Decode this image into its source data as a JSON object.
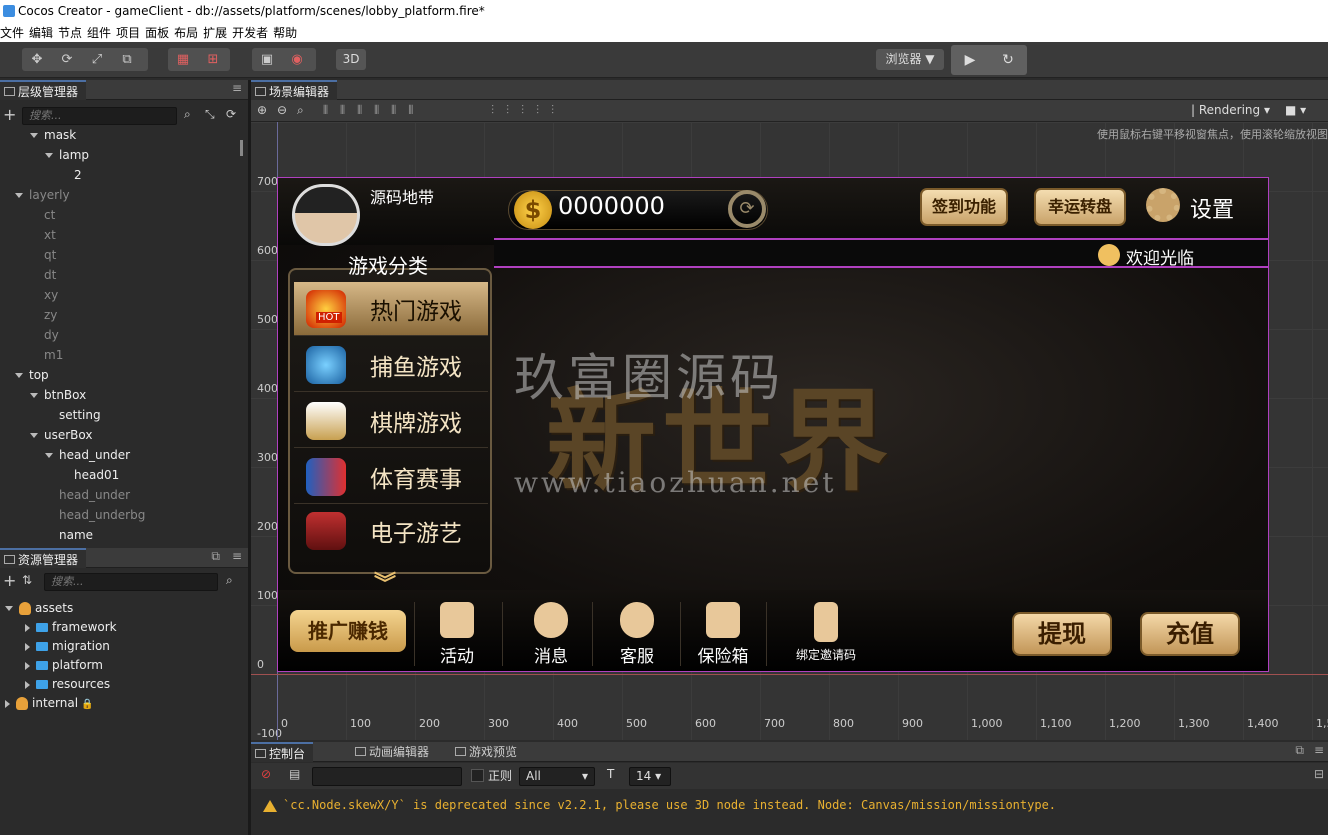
{
  "window": {
    "title": "Cocos Creator - gameClient - db://assets/platform/scenes/lobby_platform.fire*"
  },
  "menu": [
    "文件",
    "编辑",
    "节点",
    "组件",
    "项目",
    "面板",
    "布局",
    "扩展",
    "开发者",
    "帮助"
  ],
  "toolbar": {
    "mode_3d": "3D",
    "browser": "浏览器 ▼",
    "play": "▶",
    "reload": "↻"
  },
  "hierarchy": {
    "tab": "层级管理器",
    "search_placeholder": "搜索...",
    "items": [
      {
        "label": "mask",
        "depth": 2,
        "expanded": true,
        "dim": false
      },
      {
        "label": "lamp",
        "depth": 3,
        "expanded": true,
        "dim": false
      },
      {
        "label": "2",
        "depth": 4,
        "expanded": null,
        "dim": false
      },
      {
        "label": "layerly",
        "depth": 1,
        "expanded": true,
        "dim": true
      },
      {
        "label": "ct",
        "depth": 2,
        "expanded": null,
        "dim": true
      },
      {
        "label": "xt",
        "depth": 2,
        "expanded": null,
        "dim": true
      },
      {
        "label": "qt",
        "depth": 2,
        "expanded": null,
        "dim": true
      },
      {
        "label": "dt",
        "depth": 2,
        "expanded": null,
        "dim": true
      },
      {
        "label": "xy",
        "depth": 2,
        "expanded": null,
        "dim": true
      },
      {
        "label": "zy",
        "depth": 2,
        "expanded": null,
        "dim": true
      },
      {
        "label": "dy",
        "depth": 2,
        "expanded": null,
        "dim": true
      },
      {
        "label": "m1",
        "depth": 2,
        "expanded": null,
        "dim": true
      },
      {
        "label": "top",
        "depth": 1,
        "expanded": true,
        "dim": false
      },
      {
        "label": "btnBox",
        "depth": 2,
        "expanded": true,
        "dim": false
      },
      {
        "label": "setting",
        "depth": 3,
        "expanded": null,
        "dim": false
      },
      {
        "label": "userBox",
        "depth": 2,
        "expanded": true,
        "dim": false
      },
      {
        "label": "head_under",
        "depth": 3,
        "expanded": true,
        "dim": false
      },
      {
        "label": "head01",
        "depth": 4,
        "expanded": null,
        "dim": false
      },
      {
        "label": "head_under",
        "depth": 3,
        "expanded": null,
        "dim": true
      },
      {
        "label": "head_underbg",
        "depth": 3,
        "expanded": null,
        "dim": true
      },
      {
        "label": "name",
        "depth": 3,
        "expanded": null,
        "dim": false
      }
    ]
  },
  "assets": {
    "tab": "资源管理器",
    "search_placeholder": "搜索...",
    "items": [
      {
        "label": "assets",
        "depth": 0,
        "type": "db",
        "expanded": true
      },
      {
        "label": "framework",
        "depth": 1,
        "type": "folder",
        "expanded": false
      },
      {
        "label": "migration",
        "depth": 1,
        "type": "folder",
        "expanded": false
      },
      {
        "label": "platform",
        "depth": 1,
        "type": "folder",
        "expanded": false
      },
      {
        "label": "resources",
        "depth": 1,
        "type": "folder",
        "expanded": false
      },
      {
        "label": "internal",
        "depth": 0,
        "type": "db",
        "expanded": false
      }
    ]
  },
  "scene": {
    "tab": "场景编辑器",
    "rendering": "Rendering",
    "hint": "使用鼠标右键平移视窗焦点，使用滚轮缩放视图",
    "y_labels": [
      "700",
      "600",
      "500",
      "400",
      "300",
      "200",
      "100",
      "0",
      "-100"
    ],
    "x_labels": [
      "0",
      "100",
      "200",
      "300",
      "400",
      "500",
      "600",
      "700",
      "800",
      "900",
      "1,000",
      "1,100",
      "1,200",
      "1,300",
      "1,400",
      "1,5"
    ]
  },
  "game": {
    "username": "源码地带",
    "coins": "0000000",
    "signin": "签到功能",
    "lucky_wheel": "幸运转盘",
    "settings": "设置",
    "marquee": "欢迎光临",
    "category_title": "游戏分类",
    "categories": [
      "热门游戏",
      "捕鱼游戏",
      "棋牌游戏",
      "体育赛事",
      "电子游艺"
    ],
    "hot_badge": "HOT",
    "banner": "新世界",
    "watermark_cn": "玖富圈源码",
    "watermark_url": "www.tiaozhuan.net",
    "promo": "推广赚钱",
    "bottom_items": [
      "活动",
      "消息",
      "客服",
      "保险箱",
      "绑定邀请码"
    ],
    "withdraw": "提现",
    "recharge": "充值"
  },
  "console": {
    "tabs": [
      "控制台",
      "动画编辑器",
      "游戏预览"
    ],
    "regex_label": "正则",
    "filter_level": "All",
    "font_size": "14",
    "message": "`cc.Node.skewX/Y` is deprecated since v2.2.1, please use 3D node instead. Node: Canvas/mission/missiontype."
  }
}
